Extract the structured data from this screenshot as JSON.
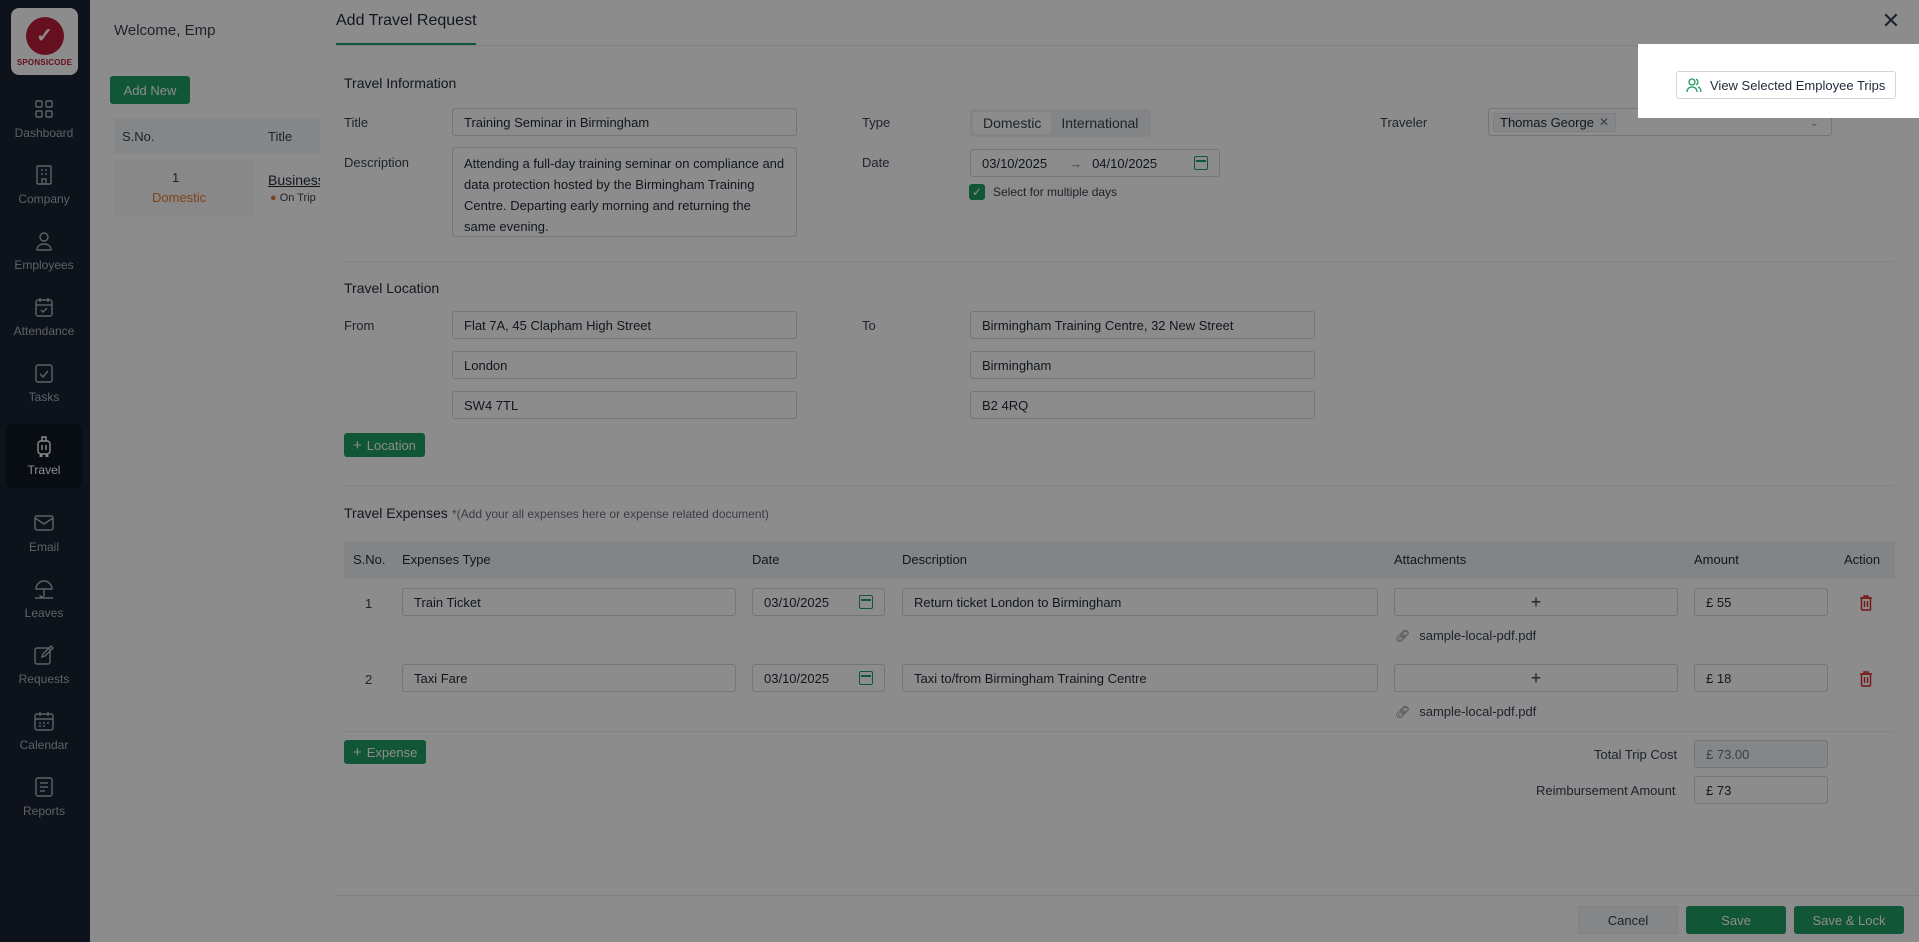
{
  "sidebar": {
    "logo_text": "SPONSICODE",
    "items": [
      {
        "label": "Dashboard",
        "icon": "grid-icon"
      },
      {
        "label": "Company",
        "icon": "building-icon"
      },
      {
        "label": "Employees",
        "icon": "user-icon"
      },
      {
        "label": "Attendance",
        "icon": "calendar-check-icon"
      },
      {
        "label": "Tasks",
        "icon": "tasks-icon"
      },
      {
        "label": "Travel",
        "icon": "luggage-icon"
      },
      {
        "label": "Email",
        "icon": "mail-icon"
      },
      {
        "label": "Leaves",
        "icon": "umbrella-icon"
      },
      {
        "label": "Requests",
        "icon": "edit-icon"
      },
      {
        "label": "Calendar",
        "icon": "calendar-icon"
      },
      {
        "label": "Reports",
        "icon": "report-icon"
      }
    ],
    "active": "Travel"
  },
  "background": {
    "welcome": "Welcome, Emp",
    "add_new": "Add New",
    "col_sno": "S.No.",
    "col_title": "Title",
    "row_num": "1",
    "row_type": "Domestic",
    "row_title": "Business",
    "row_status": "On Trip"
  },
  "modal": {
    "title": "Add Travel Request",
    "view_trips_label": "View Selected Employee Trips",
    "info": {
      "section": "Travel Information",
      "title_label": "Title",
      "title_value": "Training Seminar in Birmingham",
      "description_label": "Description",
      "description_value": "Attending a full-day training seminar on compliance and data protection hosted by the Birmingham Training Centre. Departing early morning and returning the same evening.",
      "type_label": "Type",
      "type_options": [
        "Domestic",
        "International"
      ],
      "type_selected": "Domestic",
      "date_label": "Date",
      "date_from": "03/10/2025",
      "date_to": "04/10/2025",
      "date_arrow": "→",
      "multi_day_label": "Select for multiple days",
      "traveler_label": "Traveler",
      "traveler_value": "Thomas George"
    },
    "location": {
      "section": "Travel Location",
      "from_label": "From",
      "to_label": "To",
      "from": [
        "Flat 7A, 45 Clapham High Street",
        "London",
        "SW4 7TL"
      ],
      "to": [
        "Birmingham Training Centre, 32 New Street",
        "Birmingham",
        "B2 4RQ"
      ],
      "add_button": "Location"
    },
    "expenses": {
      "section": "Travel Expenses",
      "note": "*(Add your all expenses here or expense related document)",
      "headers": [
        "S.No.",
        "Expenses Type",
        "Date",
        "Description",
        "Attachments",
        "Amount",
        "Action"
      ],
      "rows": [
        {
          "num": "1",
          "type": "Train Ticket",
          "date": "03/10/2025",
          "description": "Return ticket London to Birmingham",
          "file": "sample-local-pdf.pdf",
          "amount": "£ 55"
        },
        {
          "num": "2",
          "type": "Taxi Fare",
          "date": "03/10/2025",
          "description": "Taxi to/from Birmingham Training Centre",
          "file": "sample-local-pdf.pdf",
          "amount": "£ 18"
        }
      ],
      "add_button": "Expense",
      "total_label": "Total Trip Cost",
      "total_value": "£ 73.00",
      "reimb_label": "Reimbursement Amount",
      "reimb_value": "£ 73"
    },
    "footer": {
      "cancel": "Cancel",
      "save": "Save",
      "save_lock": "Save & Lock"
    }
  },
  "colors": {
    "accent": "#1f9d63",
    "danger": "#dc2626",
    "sidebar": "#1a2232"
  }
}
